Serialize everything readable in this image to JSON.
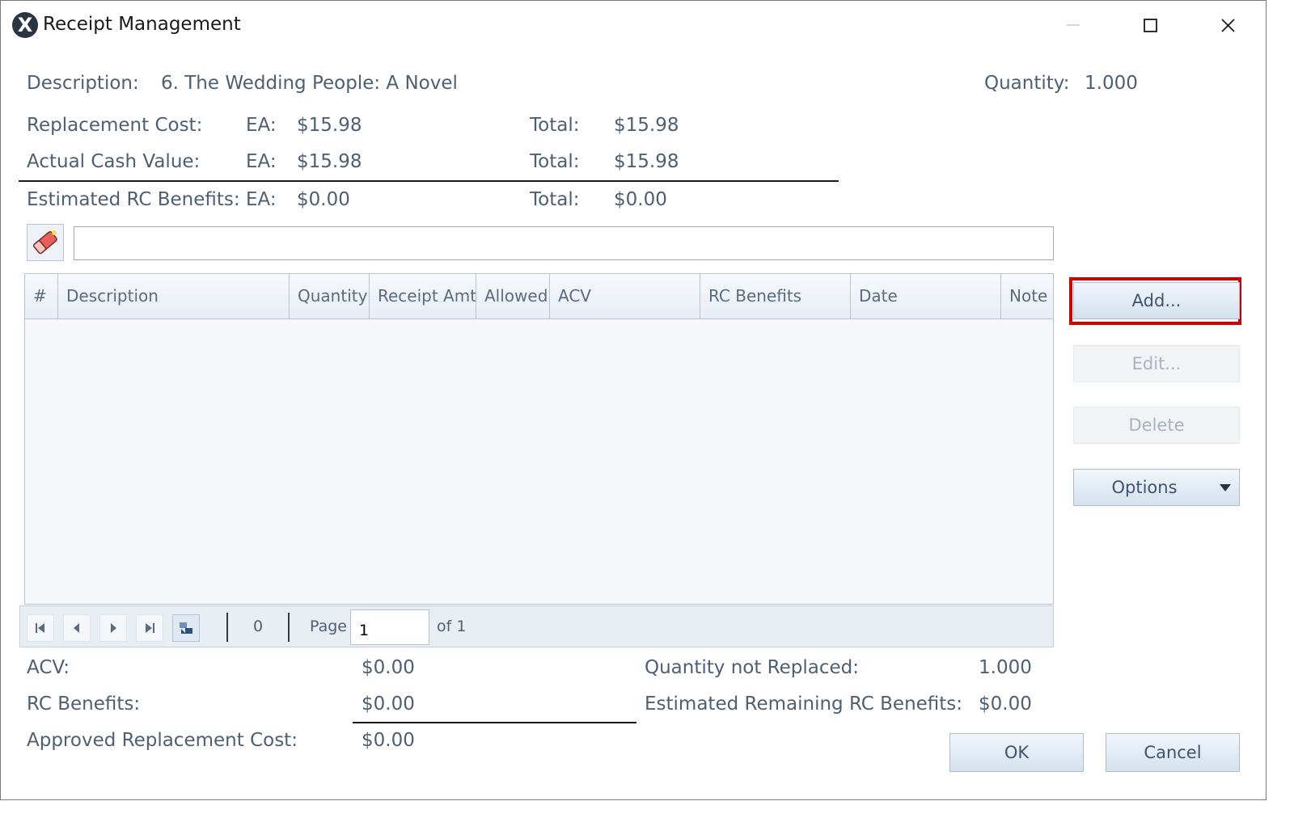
{
  "window": {
    "title": "Receipt Management",
    "logo_letter": "X"
  },
  "header": {
    "description_label": "Description:",
    "description_value": "6. The Wedding People: A Novel",
    "quantity_label": "Quantity:",
    "quantity_value": "1.000",
    "rows": [
      {
        "label": "Replacement Cost:",
        "ea_label": "EA:",
        "ea_value": "$15.98",
        "total_label": "Total:",
        "total_value": "$15.98"
      },
      {
        "label": "Actual Cash Value:",
        "ea_label": "EA:",
        "ea_value": "$15.98",
        "total_label": "Total:",
        "total_value": "$15.98"
      },
      {
        "label": "Estimated RC Benefits:",
        "ea_label": "EA:",
        "ea_value": "$0.00",
        "total_label": "Total:",
        "total_value": "$0.00"
      }
    ]
  },
  "filter": {
    "value": "",
    "placeholder": ""
  },
  "grid": {
    "columns": [
      "#",
      "Description",
      "Quantity",
      "Receipt Amt",
      "Allowed",
      "ACV",
      "RC Benefits",
      "Date",
      "Note"
    ],
    "rows": []
  },
  "pager": {
    "count": "0",
    "page_label": "Page",
    "page_value": "1",
    "of_label": "of 1"
  },
  "side_buttons": {
    "add": "Add...",
    "edit": "Edit...",
    "delete": "Delete",
    "options": "Options"
  },
  "summary": {
    "acv_label": "ACV:",
    "acv_value": "$0.00",
    "rc_label": "RC Benefits:",
    "rc_value": "$0.00",
    "arc_label": "Approved Replacement Cost:",
    "arc_value": "$0.00",
    "qnr_label": "Quantity not Replaced:",
    "qnr_value": "1.000",
    "err_label": "Estimated Remaining RC Benefits:",
    "err_value": "$0.00"
  },
  "footer": {
    "ok": "OK",
    "cancel": "Cancel"
  },
  "colors": {
    "highlight": "#cc0000",
    "text": "#4e5f73",
    "button_gradient_bottom": "#d5e1ee"
  }
}
